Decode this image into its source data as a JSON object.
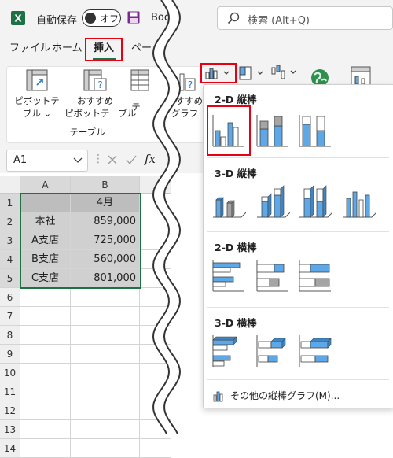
{
  "titlebar": {
    "app_icon": "excel-x-icon",
    "autosave_label": "自動保存",
    "autosave_state": "オフ",
    "file_name": "Boo",
    "search_placeholder": "検索 (Alt+Q)"
  },
  "menu": {
    "items": [
      "ファイル",
      "ホーム",
      "挿入",
      "ペー"
    ],
    "active": "挿入"
  },
  "ribbon": {
    "pivot_table": "ピボットテーブル",
    "pivot_table_line1": "ピボットテー",
    "pivot_table_line2": "ブル",
    "recommended_pivot_line1": "おすすめ",
    "recommended_pivot_line2": "ピボットテーブル",
    "table_partial": "テ",
    "group_table": "テーブル",
    "recommended_charts_line1": "おすすめ",
    "recommended_charts_line2": "グラフ"
  },
  "formula_bar": {
    "name_box": "A1",
    "fx": "fx"
  },
  "sheet": {
    "columns": [
      "A",
      "B"
    ],
    "rows": [
      "1",
      "2",
      "3",
      "4",
      "5",
      "6",
      "7",
      "8",
      "9",
      "10",
      "11",
      "12",
      "13",
      "14"
    ],
    "header_row": [
      "",
      "4月"
    ],
    "data": [
      [
        "本社",
        "859,000"
      ],
      [
        "A支店",
        "725,000"
      ],
      [
        "B支店",
        "560,000"
      ],
      [
        "C支店",
        "801,000"
      ]
    ]
  },
  "dropdown": {
    "sections": [
      "2-D 縦棒",
      "3-D 縦棒",
      "2-D 横棒",
      "3-D 横棒"
    ],
    "more_link": "その他の縦棒グラフ(M)...",
    "accent_blue": "#5ea8e8",
    "accent_gray": "#a5a5a5",
    "highlight_red": "#e60012"
  }
}
